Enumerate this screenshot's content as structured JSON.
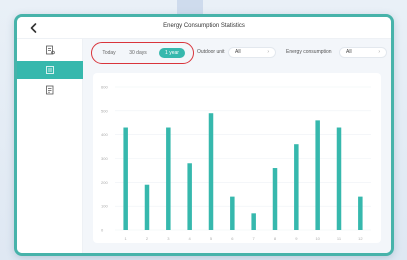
{
  "header": {
    "title": "Energy Consumption Statistics",
    "back_icon": "chevron-left-icon"
  },
  "sidebar": {
    "items": [
      {
        "name": "report",
        "icon": "report-icon",
        "active": false
      },
      {
        "name": "chart",
        "icon": "chart-icon",
        "active": true
      },
      {
        "name": "list",
        "icon": "list-icon",
        "active": false
      }
    ]
  },
  "filters": {
    "tabs": [
      {
        "label": "Today",
        "active": false
      },
      {
        "label": "30 days",
        "active": false
      },
      {
        "label": "1 year",
        "active": true
      }
    ],
    "outdoor_unit_label": "Outdoor unit",
    "outdoor_unit_value": "All",
    "energy_label": "Energy consumption",
    "energy_value": "All"
  },
  "colors": {
    "accent": "#36b8ad",
    "highlight_ring": "#d9343b"
  },
  "chart_data": {
    "type": "bar",
    "categories": [
      "1",
      "2",
      "3",
      "4",
      "5",
      "6",
      "7",
      "8",
      "9",
      "10",
      "11",
      "12"
    ],
    "values": [
      430,
      190,
      430,
      280,
      490,
      140,
      70,
      260,
      360,
      460,
      430,
      140
    ],
    "ylim": [
      0,
      600
    ],
    "yticks": [
      "0",
      "100",
      "200",
      "300",
      "400",
      "500",
      "600"
    ],
    "grid": true
  }
}
